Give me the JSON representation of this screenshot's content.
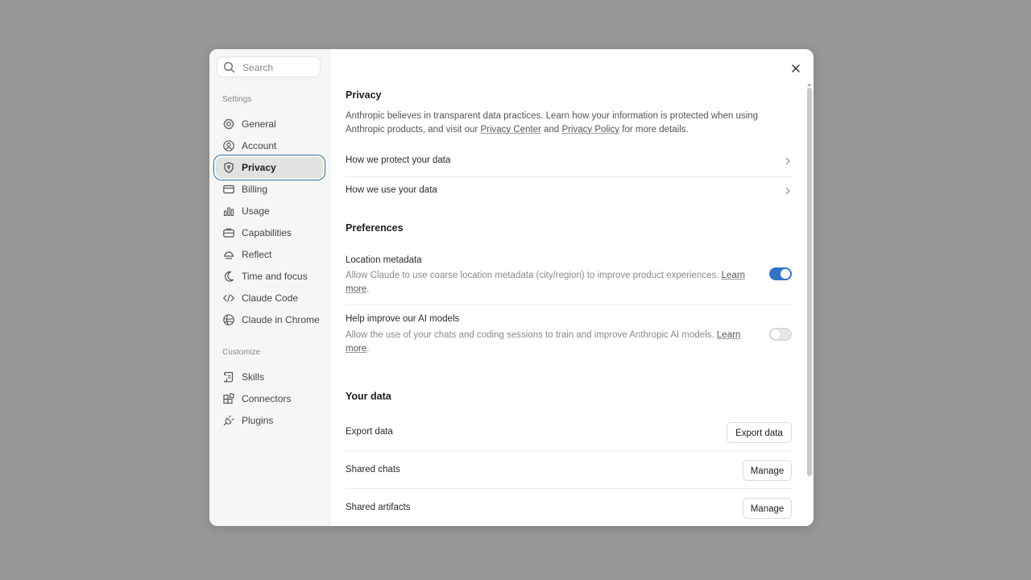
{
  "search": {
    "placeholder": "Search",
    "icon": "search-icon"
  },
  "sidebar": {
    "settings_label": "Settings",
    "customize_label": "Customize",
    "settings_items": [
      {
        "label": "General",
        "icon": "gear-icon"
      },
      {
        "label": "Account",
        "icon": "user-circle-icon"
      },
      {
        "label": "Privacy",
        "icon": "shield-icon",
        "active": true
      },
      {
        "label": "Billing",
        "icon": "credit-card-icon"
      },
      {
        "label": "Usage",
        "icon": "bar-chart-icon"
      },
      {
        "label": "Capabilities",
        "icon": "briefcase-icon"
      },
      {
        "label": "Reflect",
        "icon": "sunrise-icon"
      },
      {
        "label": "Time and focus",
        "icon": "moon-icon"
      },
      {
        "label": "Claude Code",
        "icon": "code-icon"
      },
      {
        "label": "Claude in Chrome",
        "icon": "globe-icon"
      }
    ],
    "customize_items": [
      {
        "label": "Skills",
        "icon": "scroll-icon"
      },
      {
        "label": "Connectors",
        "icon": "blocks-icon"
      },
      {
        "label": "Plugins",
        "icon": "plug-icon"
      }
    ]
  },
  "privacy": {
    "title": "Privacy",
    "intro_pre": "Anthropic believes in transparent data practices. Learn how your information is protected when using Anthropic products, and visit our ",
    "privacy_center": "Privacy Center",
    "and": " and ",
    "privacy_policy": "Privacy Policy",
    "intro_post": " for more details.",
    "links": [
      "How we protect your data",
      "How we use your data"
    ]
  },
  "preferences": {
    "title": "Preferences",
    "location": {
      "title": "Location metadata",
      "desc": "Allow Claude to use coarse location metadata (city/region) to improve product experiences. ",
      "learn_more": "Learn more",
      "enabled": true
    },
    "improve": {
      "title": "Help improve our AI models",
      "desc": "Allow the use of your chats and coding sessions to train and improve Anthropic AI models. ",
      "learn_more": "Learn more",
      "enabled": false
    },
    "accent_color": "#2f74c7"
  },
  "your_data": {
    "title": "Your data",
    "rows": [
      {
        "label": "Export data",
        "button": "Export data"
      },
      {
        "label": "Shared chats",
        "button": "Manage"
      },
      {
        "label": "Shared artifacts",
        "button": "Manage"
      }
    ]
  }
}
